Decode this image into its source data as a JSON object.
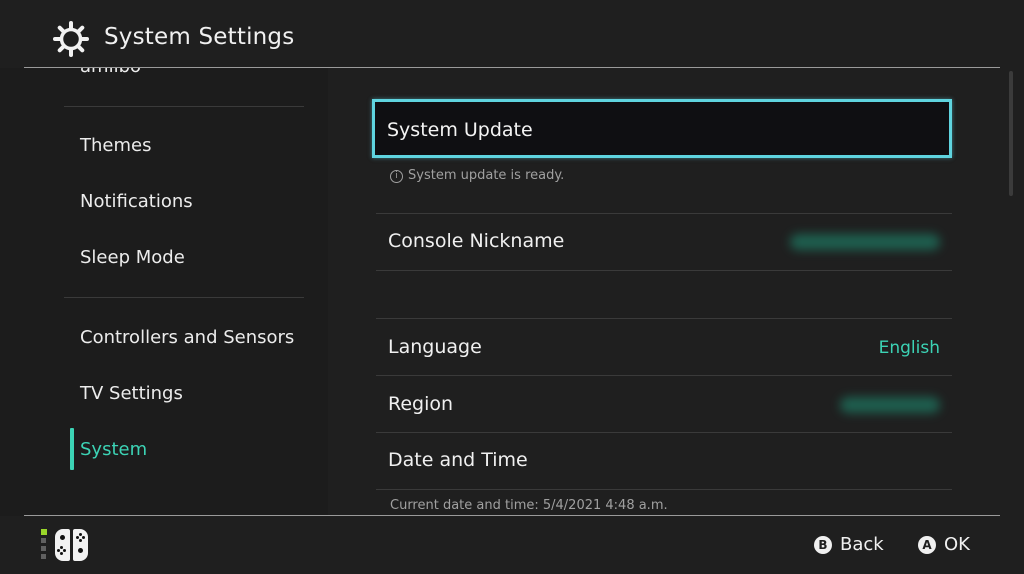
{
  "header": {
    "title": "System Settings",
    "icon": "gear-icon"
  },
  "sidebar": {
    "partial_item": "amiibo",
    "items": [
      {
        "label": "Themes"
      },
      {
        "label": "Notifications"
      },
      {
        "label": "Sleep Mode"
      },
      {
        "label": "Controllers and Sensors"
      },
      {
        "label": "TV Settings"
      },
      {
        "label": "System",
        "active": true
      }
    ]
  },
  "main": {
    "rows": [
      {
        "label": "System Update",
        "note": "System update is ready.",
        "selected": true
      },
      {
        "label": "Console Nickname",
        "value": "[blurred]"
      },
      {
        "label": "Language",
        "value": "English"
      },
      {
        "label": "Region",
        "value": "[blurred]"
      },
      {
        "label": "Date and Time",
        "note": "Current date and time: 5/4/2021 4:48 a.m."
      }
    ]
  },
  "footer": {
    "back": {
      "button": "B",
      "label": "Back"
    },
    "ok": {
      "button": "A",
      "label": "OK"
    }
  },
  "colors": {
    "accent": "#3cd3b5",
    "focus_border": "#5fd4df",
    "background": "#1f1f1f"
  }
}
